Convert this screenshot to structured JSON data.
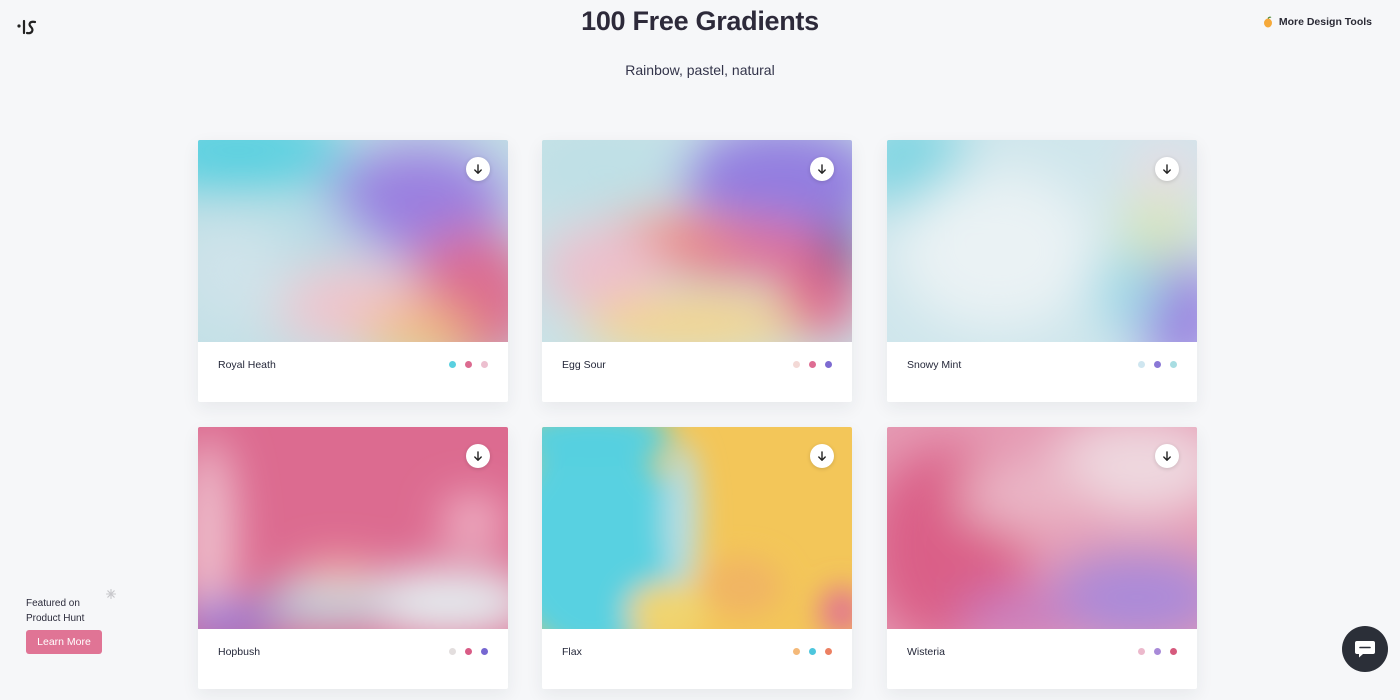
{
  "header": {
    "title": "100 Free Gradients",
    "subtitle": "Rainbow, pastel, natural",
    "tools_link": "More Design Tools",
    "logo_icon": "brand-logo-icon",
    "tools_icon": "peach-emoji-icon"
  },
  "cards": [
    {
      "name": "Royal Heath",
      "colors": [
        "#5ad0e0",
        "#dc6b90",
        "#ecbfcf"
      ],
      "icon": "download-icon"
    },
    {
      "name": "Egg Sour",
      "colors": [
        "#f3d9d6",
        "#de6d93",
        "#7d6bd1"
      ],
      "icon": "download-icon"
    },
    {
      "name": "Snowy Mint",
      "colors": [
        "#cfe6f0",
        "#8a78d6",
        "#a8dde2"
      ],
      "icon": "download-icon"
    },
    {
      "name": "Hopbush",
      "colors": [
        "#e3dede",
        "#d95c86",
        "#7667d1"
      ],
      "icon": "download-icon"
    },
    {
      "name": "Flax",
      "colors": [
        "#f4b979",
        "#4dc6dd",
        "#ec8062"
      ],
      "icon": "download-icon"
    },
    {
      "name": "Wisteria",
      "colors": [
        "#ecb9cc",
        "#a88ad8",
        "#d65a7d"
      ],
      "icon": "download-icon"
    }
  ],
  "product_hunt": {
    "line1": "Featured on",
    "line2": "Product Hunt",
    "button": "Learn More",
    "icon": "sparkle-icon"
  },
  "chat": {
    "icon": "chat-bubble-icon"
  },
  "colors": {
    "background": "#f6f7f9",
    "learn_more_button": "#e07495",
    "chat_button": "#2b2f38"
  }
}
